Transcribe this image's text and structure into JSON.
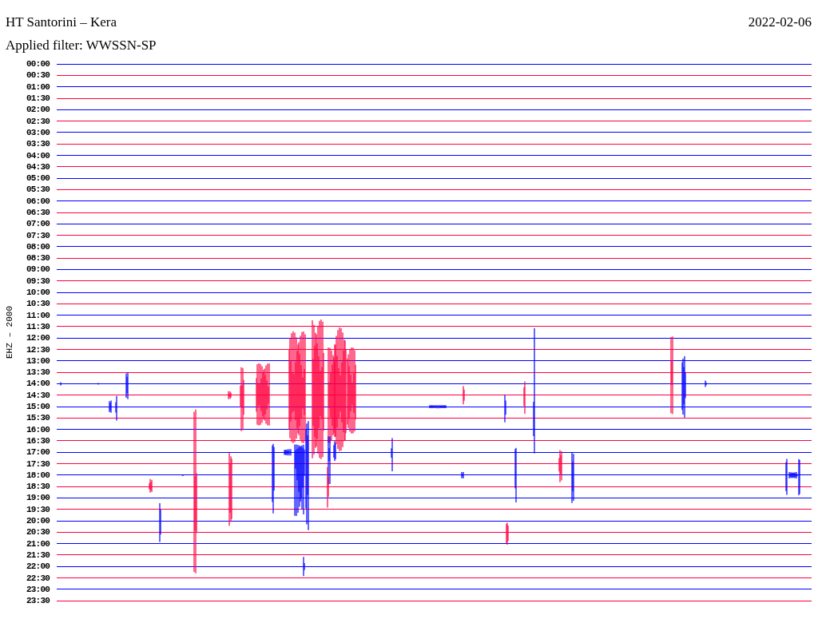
{
  "header": {
    "title": "HT Santorini – Kera",
    "date": "2022-02-06",
    "filter": "Applied filter: WWSSN-SP"
  },
  "channel_label": "EHZ – 2000",
  "rows": [
    {
      "label": "00:00",
      "color": "#0000ff"
    },
    {
      "label": "00:30",
      "color": "#ff0040"
    },
    {
      "label": "01:00",
      "color": "#0000ff"
    },
    {
      "label": "01:30",
      "color": "#ff0040"
    },
    {
      "label": "02:00",
      "color": "#0000ff"
    },
    {
      "label": "02:30",
      "color": "#ff0040"
    },
    {
      "label": "03:00",
      "color": "#0000ff"
    },
    {
      "label": "03:30",
      "color": "#ff0040"
    },
    {
      "label": "04:00",
      "color": "#0000ff"
    },
    {
      "label": "04:30",
      "color": "#ff0040"
    },
    {
      "label": "05:00",
      "color": "#0000ff"
    },
    {
      "label": "05:30",
      "color": "#ff0040"
    },
    {
      "label": "06:00",
      "color": "#0000ff"
    },
    {
      "label": "06:30",
      "color": "#ff0040"
    },
    {
      "label": "07:00",
      "color": "#0000ff"
    },
    {
      "label": "07:30",
      "color": "#ff0040"
    },
    {
      "label": "08:00",
      "color": "#0000ff"
    },
    {
      "label": "08:30",
      "color": "#ff0040"
    },
    {
      "label": "09:00",
      "color": "#0000ff"
    },
    {
      "label": "09:30",
      "color": "#ff0040"
    },
    {
      "label": "10:00",
      "color": "#0000ff"
    },
    {
      "label": "10:30",
      "color": "#ff0040"
    },
    {
      "label": "11:00",
      "color": "#0000ff"
    },
    {
      "label": "11:30",
      "color": "#ff0040"
    },
    {
      "label": "12:00",
      "color": "#0000ff"
    },
    {
      "label": "12:30",
      "color": "#ff0040"
    },
    {
      "label": "13:00",
      "color": "#0000ff"
    },
    {
      "label": "13:30",
      "color": "#ff0040"
    },
    {
      "label": "14:00",
      "color": "#0000ff"
    },
    {
      "label": "14:30",
      "color": "#ff0040"
    },
    {
      "label": "15:00",
      "color": "#0000ff"
    },
    {
      "label": "15:30",
      "color": "#ff0040"
    },
    {
      "label": "16:00",
      "color": "#0000ff"
    },
    {
      "label": "16:30",
      "color": "#ff0040"
    },
    {
      "label": "17:00",
      "color": "#0000ff"
    },
    {
      "label": "17:30",
      "color": "#ff0040"
    },
    {
      "label": "18:00",
      "color": "#0000ff"
    },
    {
      "label": "18:30",
      "color": "#ff0040"
    },
    {
      "label": "19:00",
      "color": "#0000ff"
    },
    {
      "label": "19:30",
      "color": "#ff0040"
    },
    {
      "label": "20:00",
      "color": "#0000ff"
    },
    {
      "label": "20:30",
      "color": "#ff0040"
    },
    {
      "label": "21:00",
      "color": "#0000ff"
    },
    {
      "label": "21:30",
      "color": "#ff0040"
    },
    {
      "label": "22:00",
      "color": "#0000ff"
    },
    {
      "label": "22:30",
      "color": "#ff0040"
    },
    {
      "label": "23:00",
      "color": "#0000ff"
    },
    {
      "label": "23:30",
      "color": "#ff0040"
    }
  ]
}
